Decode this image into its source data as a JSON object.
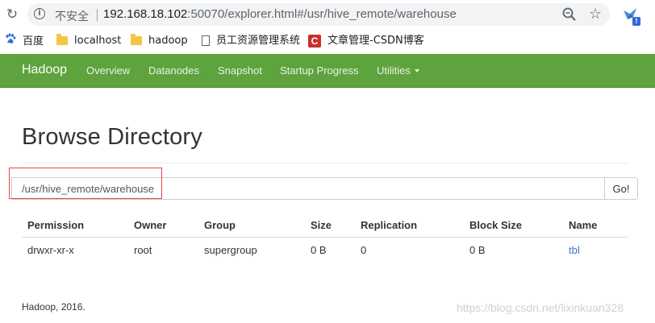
{
  "browser": {
    "security_label": "不安全",
    "url_host": "192.168.18.102",
    "url_rest": ":50070/explorer.html#/usr/hive_remote/warehouse",
    "ext_badge": "!"
  },
  "bookmarks": [
    {
      "label": "百度",
      "icon": "baidu-icon"
    },
    {
      "label": "localhost",
      "icon": "folder-icon"
    },
    {
      "label": "hadoop",
      "icon": "folder-icon"
    },
    {
      "label": "员工资源管理系统",
      "icon": "page-icon"
    },
    {
      "label": "文章管理-CSDN博客",
      "icon": "csdn-icon",
      "glyph": "C"
    }
  ],
  "navbar": {
    "brand": "Hadoop",
    "items": [
      "Overview",
      "Datanodes",
      "Snapshot",
      "Startup Progress",
      "Utilities"
    ]
  },
  "page": {
    "title": "Browse Directory",
    "path_value": "/usr/hive_remote/warehouse",
    "go_label": "Go!"
  },
  "table": {
    "headers": [
      "Permission",
      "Owner",
      "Group",
      "Size",
      "Replication",
      "Block Size",
      "Name"
    ],
    "rows": [
      [
        "drwxr-xr-x",
        "root",
        "supergroup",
        "0 B",
        "0",
        "0 B",
        "tbl"
      ]
    ]
  },
  "footer": "Hadoop, 2016.",
  "watermark": "https://blog.csdn.net/lixinkuan328",
  "colors": {
    "navbar": "#5fa33e",
    "link": "#3b7bbf",
    "highlight": "#e0484a"
  }
}
